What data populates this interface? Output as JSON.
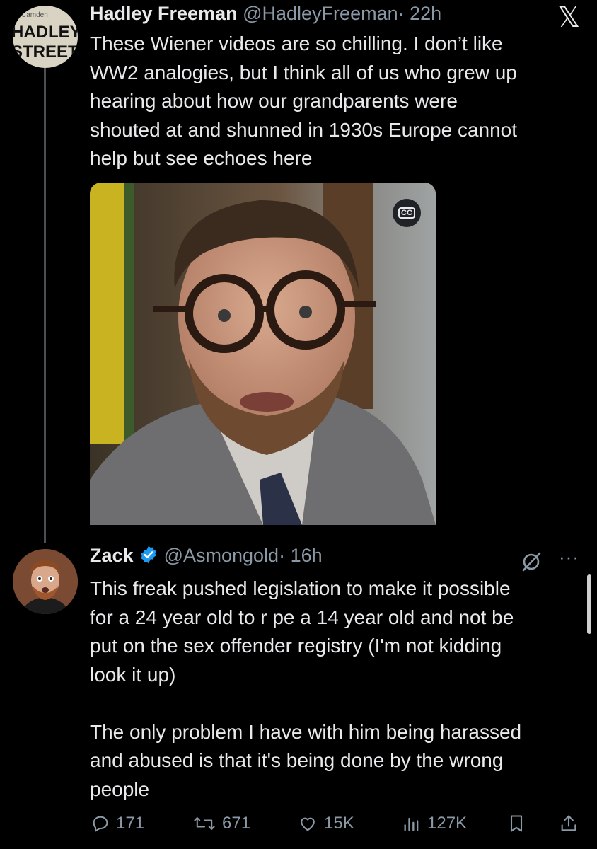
{
  "tweet1": {
    "avatar_text": {
      "small": "Camden",
      "line1": "HADLEY",
      "line2": "STREET"
    },
    "name": "Hadley Freeman",
    "handle": "@HadleyFreeman",
    "time": "· 22h",
    "text": "These Wiener videos are so chilling. I don’t like\nWW2 analogies, but I think all of us who grew up\nhearing about how our grandparents were\nshouted at and shunned in 1930s Europe cannot\nhelp but see echoes here",
    "cc_label": "CC"
  },
  "tweet2": {
    "name": "Zack",
    "handle": "@Asmongold",
    "time": "· 16h",
    "text": "This freak pushed legislation to make it possible\nfor a 24 year old to r  pe a 14 year old and not be\nput on the sex offender registry (I'm not kidding\nlook it up)\n\nThe only problem I have with him being harassed\nand abused is that it's being done by the wrong\npeople",
    "more": "···",
    "actions": {
      "replies": "171",
      "reposts": "671",
      "likes": "15K",
      "views": "127K"
    }
  },
  "icons": [
    "x-logo-icon",
    "cc-icon",
    "verified-badge-icon",
    "grok-icon",
    "more-icon",
    "reply-icon",
    "repost-icon",
    "like-icon",
    "views-icon",
    "bookmark-icon",
    "share-icon"
  ],
  "colors": {
    "background": "#000000",
    "text": "#e7e9ea",
    "secondary": "#8b98a5",
    "verified": "#1d9bf0",
    "divider": "#2f3336"
  }
}
